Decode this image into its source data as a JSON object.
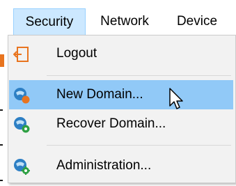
{
  "menubar": {
    "items": [
      {
        "label": "Security",
        "active": true
      },
      {
        "label": "Network",
        "active": false
      },
      {
        "label": "Device",
        "active": false
      }
    ]
  },
  "security_menu": {
    "items": [
      {
        "label": "Logout",
        "icon": "logout-icon",
        "highlighted": false
      },
      {
        "label": "New Domain...",
        "icon": "new-domain-icon",
        "highlighted": true
      },
      {
        "label": "Recover Domain...",
        "icon": "recover-domain-icon",
        "highlighted": false
      },
      {
        "label": "Administration...",
        "icon": "administration-icon",
        "highlighted": false
      }
    ]
  },
  "colors": {
    "menubar_active_bg": "#cce8ff",
    "menu_bg": "#f2f2f2",
    "highlight_bg": "#91c9f7",
    "icon_blue": "#2d7fc4",
    "icon_orange": "#e8741f",
    "icon_green": "#2ea043"
  },
  "cursor": "arrow-pointer"
}
